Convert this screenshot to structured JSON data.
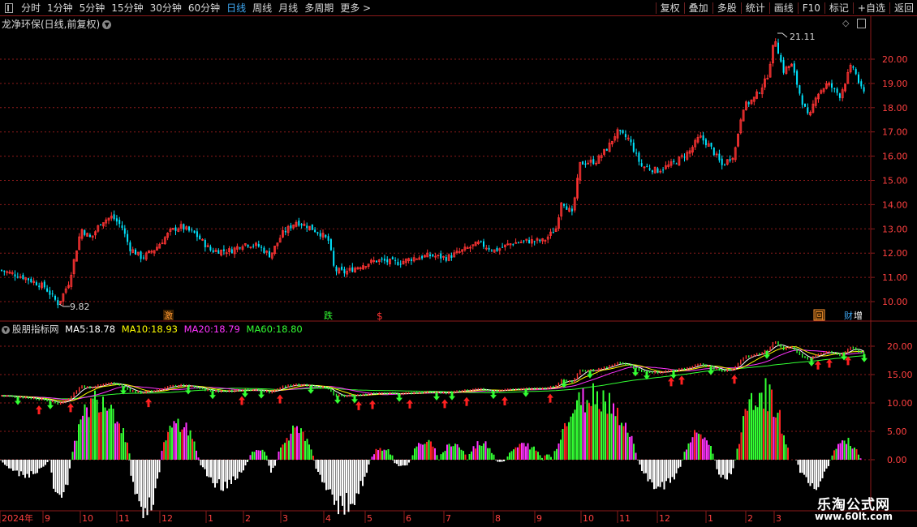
{
  "toolbar": {
    "periods": [
      "分时",
      "1分钟",
      "5分钟",
      "15分钟",
      "30分钟",
      "60分钟",
      "日线",
      "周线",
      "月线",
      "多周期",
      "更多 >"
    ],
    "active_period": "日线",
    "actions": [
      "复权",
      "叠加",
      "多股",
      "统计",
      "画线",
      "F10",
      "标记",
      "+自选",
      "返回"
    ]
  },
  "main_chart": {
    "title": "龙净环保(日线,前复权)",
    "high_label": "21.11",
    "low_label": "9.82",
    "y_ticks": [
      "20.00",
      "19.00",
      "18.00",
      "17.00",
      "16.00",
      "15.00",
      "14.00",
      "13.00",
      "12.00",
      "11.00",
      "10.00"
    ],
    "event_markers": [
      "激",
      "跌",
      "$",
      "回",
      "财",
      "增"
    ]
  },
  "indicator": {
    "name": "股朋指标网",
    "ma5_label": "MA5:",
    "ma5_value": "18.78",
    "ma10_label": "MA10:",
    "ma10_value": "18.93",
    "ma20_label": "MA20:",
    "ma20_value": "18.79",
    "ma60_label": "MA60:",
    "ma60_value": "18.80",
    "y_ticks": [
      "20.00",
      "15.00",
      "10.00",
      "5.00",
      "0.00"
    ]
  },
  "x_axis": {
    "labels": [
      "2024年",
      "9",
      "10",
      "11",
      "12",
      "1",
      "2",
      "3",
      "4",
      "5",
      "6",
      "7",
      "8",
      "9",
      "10",
      "11",
      "12",
      "1",
      "2",
      "3"
    ]
  },
  "watermark": {
    "line1": "乐淘公式网",
    "line2": "www.60lt.com"
  },
  "colors": {
    "up": "#ff3333",
    "down": "#00e5ff",
    "grid": "#8b1a1a",
    "ma5": "#ffffff",
    "ma10": "#ffff00",
    "ma20": "#ff33ff",
    "ma60": "#33ff33",
    "hist_green": "#33ff33",
    "hist_red": "#ff2222",
    "hist_magenta": "#ff33ff",
    "active_tab": "#3fa9f5"
  }
}
